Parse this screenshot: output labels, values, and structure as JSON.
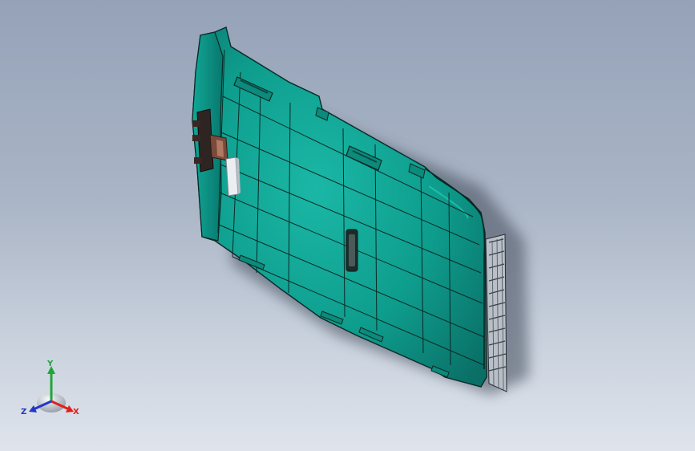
{
  "triad": {
    "x_label": "X",
    "y_label": "Y",
    "z_label": "Z",
    "x_color": "#e0201c",
    "y_color": "#1fa63a",
    "z_color": "#2236c8"
  },
  "model": {
    "body_color": "#0d9e8e",
    "edge_color": "#0a2a26",
    "shadow_color": "#4c5566"
  }
}
